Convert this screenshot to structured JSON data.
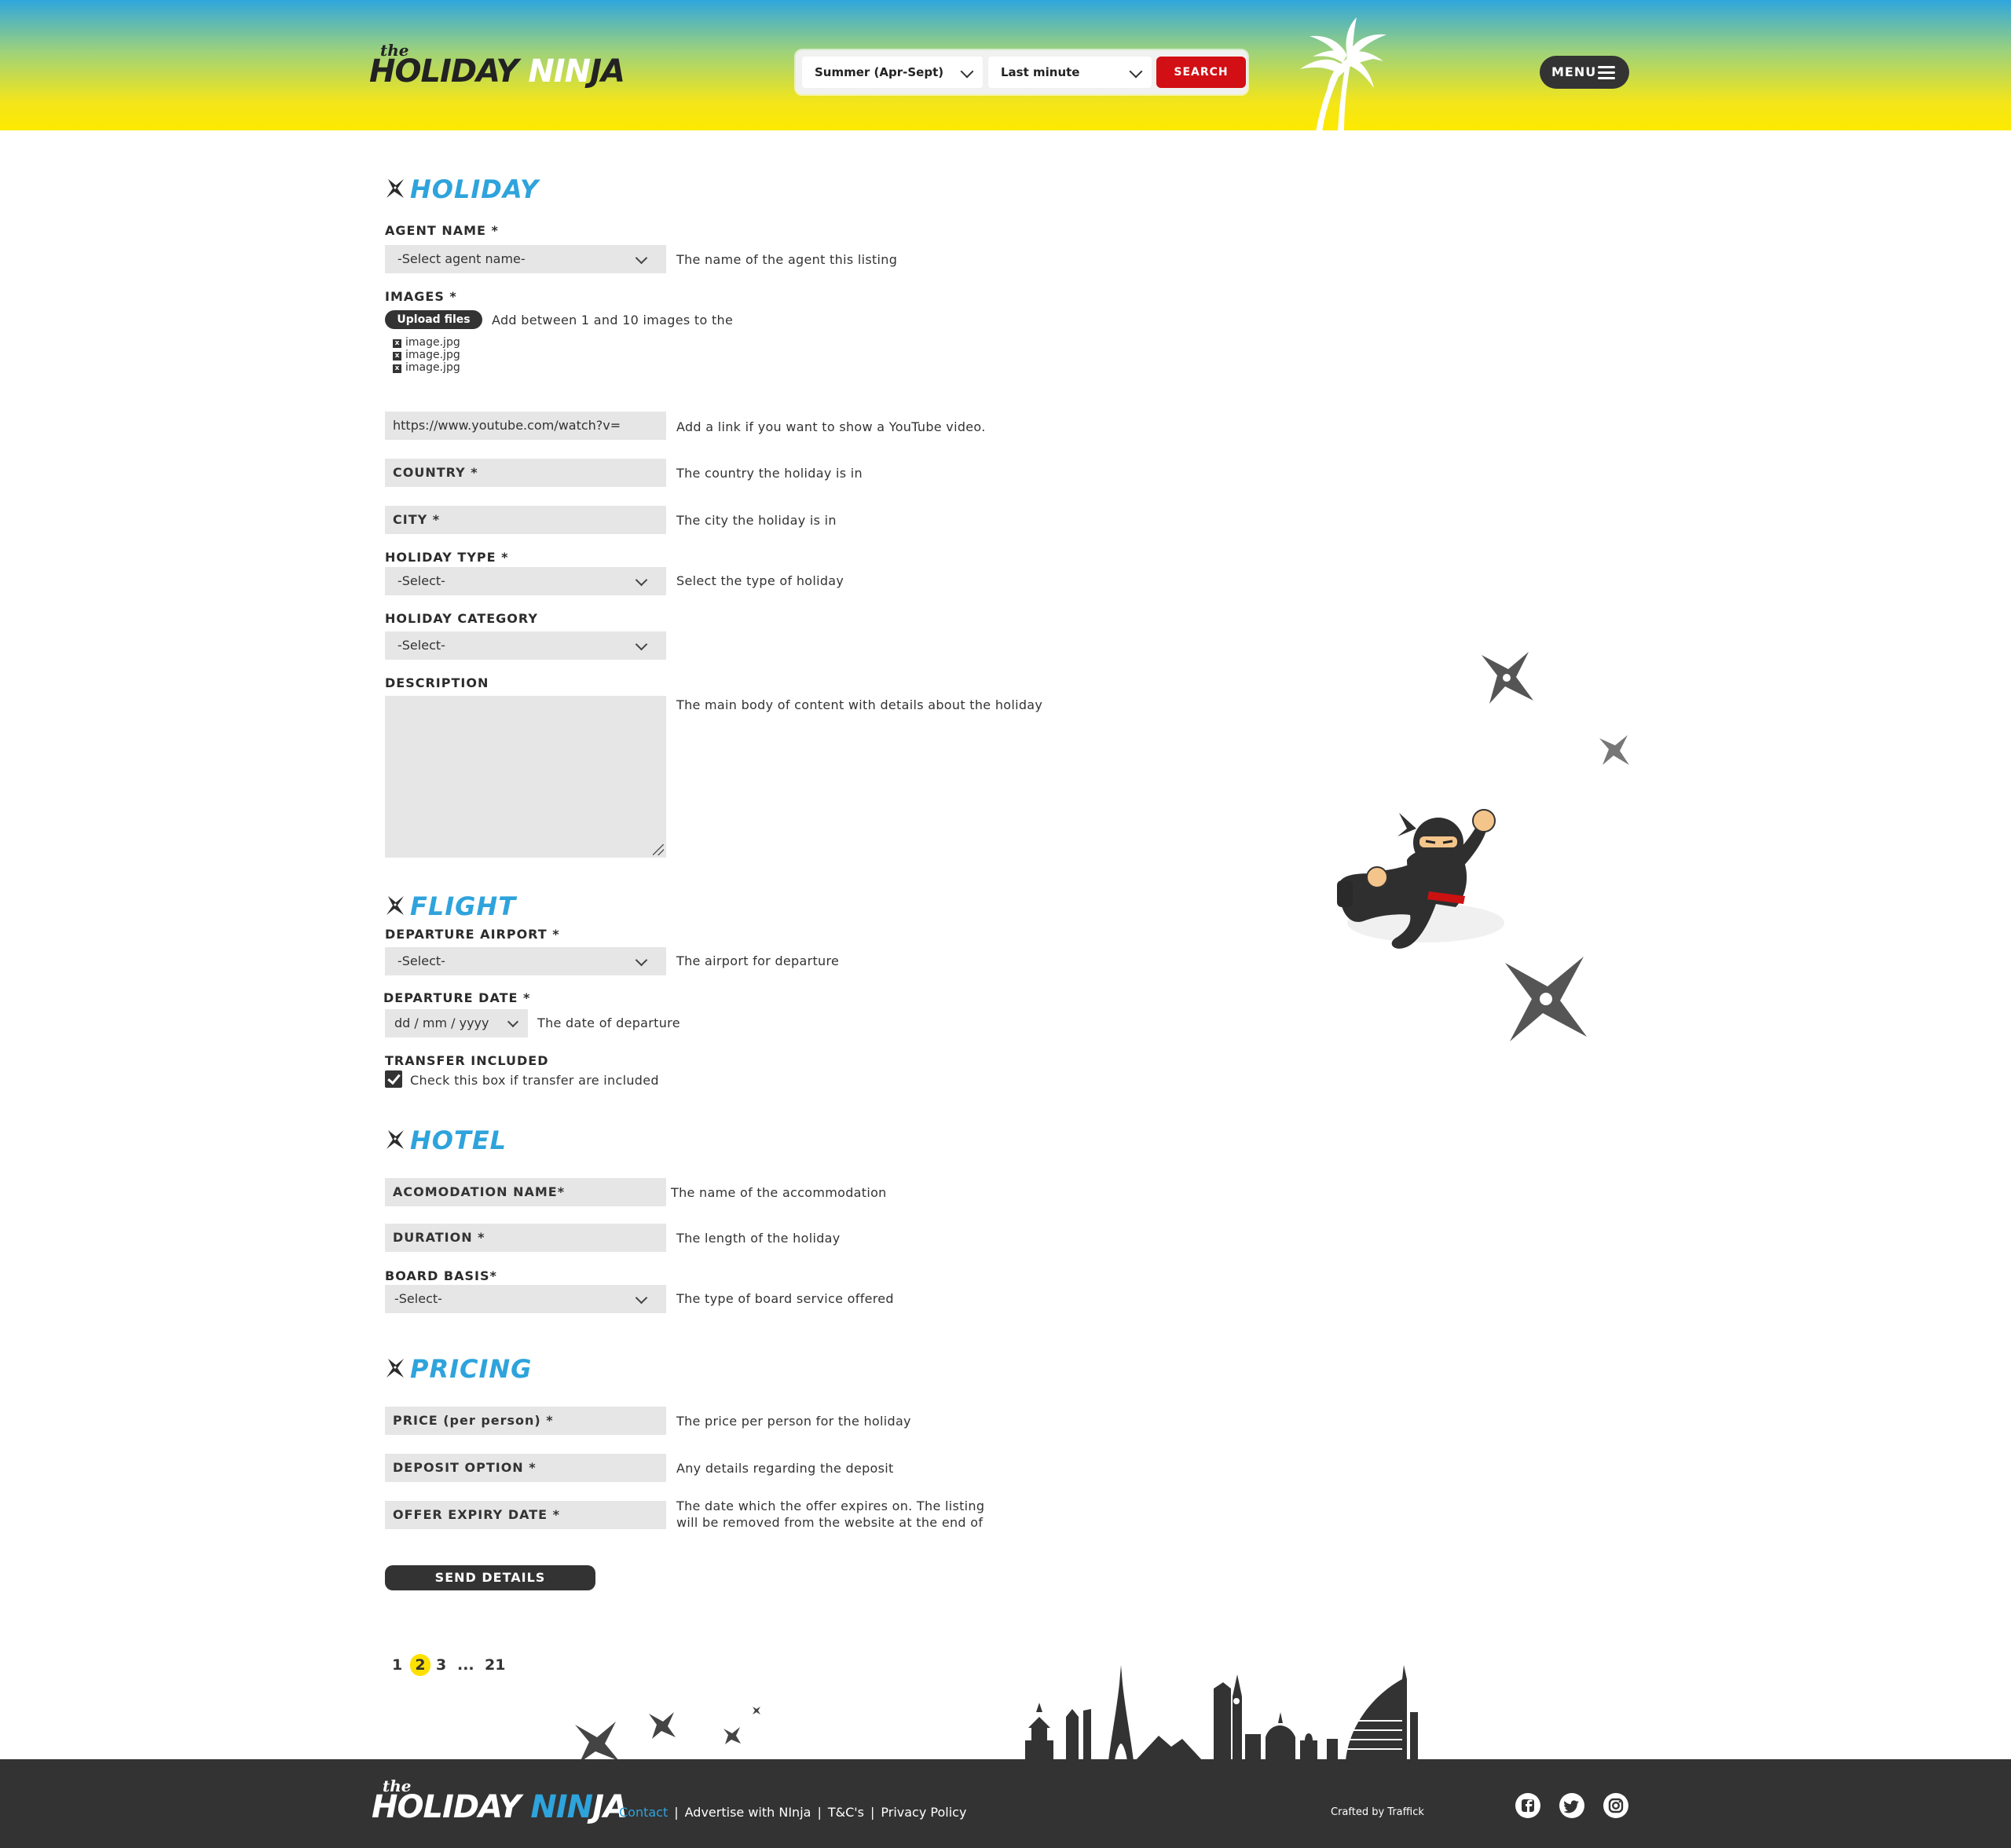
{
  "header": {
    "logo": {
      "small": "the",
      "word_a": "HOLIDAY ",
      "word_b": "NIN",
      "word_c": "JA"
    },
    "season_select": "Summer (Apr-Sept)",
    "type_select": "Last minute",
    "search_label": "SEARCH",
    "menu_label": "MENU"
  },
  "sections": {
    "holiday": "HOLIDAY",
    "flight": "FLIGHT",
    "hotel": "HOTEL",
    "pricing": "PRICING"
  },
  "form": {
    "agent": {
      "label": "AGENT NAME *",
      "value": "-Select agent name-",
      "help": "The name of the agent this listing"
    },
    "images": {
      "label": "IMAGES *",
      "button": "Upload files",
      "help": "Add between 1 and 10 images to the",
      "files": [
        "image.jpg",
        "image.jpg",
        "image.jpg"
      ],
      "remove": "x"
    },
    "youtube": {
      "value": "https://www.youtube.com/watch?v=",
      "help": "Add a link if you want to show a YouTube video."
    },
    "country": {
      "placeholder": "COUNTRY *",
      "help": "The country the holiday is in"
    },
    "city": {
      "placeholder": "CITY *",
      "help": "The city the holiday is in"
    },
    "holiday_type": {
      "label": "HOLIDAY TYPE *",
      "value": "-Select-",
      "help": "Select the type of holiday"
    },
    "holiday_category": {
      "label": "HOLIDAY CATEGORY",
      "value": "-Select-"
    },
    "description": {
      "label": "DESCRIPTION",
      "help": "The main body of content with details about the holiday"
    },
    "departure_airport": {
      "label": "DEPARTURE AIRPORT *",
      "value": "-Select-",
      "help": "The airport for departure"
    },
    "departure_date": {
      "label": "DEPARTURE DATE *",
      "value": "dd / mm / yyyy",
      "help": "The date of departure"
    },
    "transfer": {
      "label": "TRANSFER INCLUDED",
      "help": "Check this box if transfer are included",
      "checked": true
    },
    "accommodation": {
      "placeholder": "ACOMODATION NAME*",
      "help": "The name of the accommodation"
    },
    "duration": {
      "placeholder": "DURATION *",
      "help": "The length of the holiday"
    },
    "board": {
      "label": "BOARD BASIS*",
      "value": "-Select-",
      "help": "The type of board service offered"
    },
    "price": {
      "placeholder": "PRICE (per person) *",
      "help": "The price per person for the holiday"
    },
    "deposit": {
      "placeholder": "DEPOSIT OPTION *",
      "help": "Any details regarding the deposit"
    },
    "expiry": {
      "placeholder": "OFFER EXPIRY DATE *",
      "help_line1": "The date which the offer expires on. The listing",
      "help_line2": "will be removed from the website at the end of"
    },
    "submit": "SEND DETAILS"
  },
  "pagination": {
    "pages": [
      "1",
      "2",
      "3",
      "...",
      "21"
    ],
    "current": "2"
  },
  "footer": {
    "logo": {
      "small": "the",
      "word_a": "HOLIDAY ",
      "word_b": "NIN",
      "word_c": "JA"
    },
    "links": [
      "Contact",
      "Advertise with NInja",
      "T&C's",
      "Privacy Policy"
    ],
    "separator": "|",
    "crafted": "Crafted by Traffick"
  },
  "colors": {
    "accent_blue": "#2ea3dc",
    "search_red": "#d20f14",
    "dark": "#333333",
    "page_highlight": "#fde000"
  },
  "icons": [
    "shuriken-icon",
    "palm-tree-icon",
    "hamburger-icon",
    "chevron-down-icon",
    "facebook-icon",
    "twitter-icon",
    "instagram-icon",
    "ninja-illustration",
    "skyline-illustration"
  ]
}
